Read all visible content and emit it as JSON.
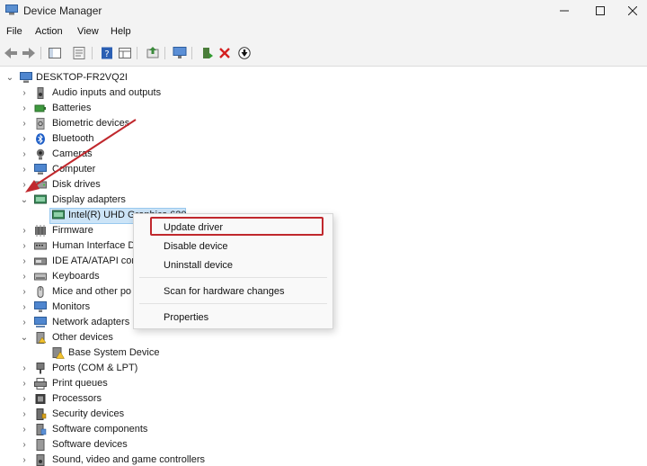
{
  "window": {
    "title": "Device Manager",
    "minimize": "—",
    "maximize": "☐",
    "close": "✕"
  },
  "menu": {
    "file": "File",
    "action": "Action",
    "view": "View",
    "help": "Help"
  },
  "toolbar_icons": [
    "back-icon",
    "forward-icon",
    "show-hide-tree-icon",
    "properties-icon",
    "help-icon",
    "view-resources-icon",
    "update-driver-icon",
    "scan-hardware-icon",
    "add-legacy-icon",
    "uninstall-icon",
    "disable-icon"
  ],
  "tree": {
    "root": "DESKTOP-FR2VQ2I",
    "items": [
      {
        "label": "Audio inputs and outputs"
      },
      {
        "label": "Batteries"
      },
      {
        "label": "Biometric devices"
      },
      {
        "label": "Bluetooth"
      },
      {
        "label": "Cameras"
      },
      {
        "label": "Computer"
      },
      {
        "label": "Disk drives"
      },
      {
        "label": "Display adapters"
      },
      {
        "label": "Intel(R) UHD Graphics 620"
      },
      {
        "label": "Firmware"
      },
      {
        "label": "Human Interface D"
      },
      {
        "label": "IDE ATA/ATAPI cont"
      },
      {
        "label": "Keyboards"
      },
      {
        "label": "Mice and other po"
      },
      {
        "label": "Monitors"
      },
      {
        "label": "Network adapters"
      },
      {
        "label": "Other devices"
      },
      {
        "label": "Base System Device"
      },
      {
        "label": "Ports (COM & LPT)"
      },
      {
        "label": "Print queues"
      },
      {
        "label": "Processors"
      },
      {
        "label": "Security devices"
      },
      {
        "label": "Software components"
      },
      {
        "label": "Software devices"
      },
      {
        "label": "Sound, video and game controllers"
      }
    ]
  },
  "context_menu": {
    "update_driver": "Update driver",
    "disable_device": "Disable device",
    "uninstall_device": "Uninstall device",
    "scan_changes": "Scan for hardware changes",
    "properties": "Properties"
  },
  "colors": {
    "annotation": "#c0282d",
    "selection": "#cce4f7"
  }
}
